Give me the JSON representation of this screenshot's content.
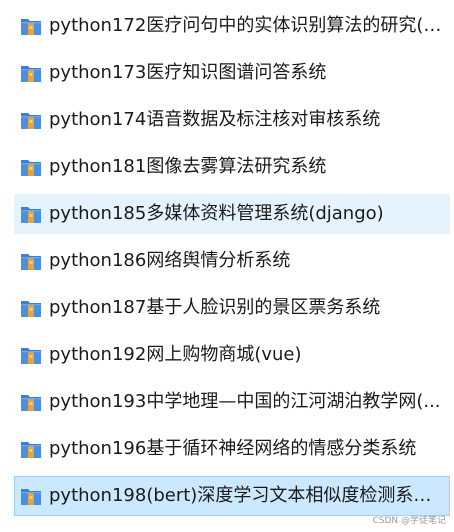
{
  "folders": [
    {
      "name": "python172医疗问句中的实体识别算法的研究(f...",
      "state": "normal"
    },
    {
      "name": "python173医疗知识图谱问答系统",
      "state": "normal"
    },
    {
      "name": "python174语音数据及标注核对审核系统",
      "state": "normal"
    },
    {
      "name": "python181图像去雾算法研究系统",
      "state": "normal"
    },
    {
      "name": "python185多媒体资料管理系统(django)",
      "state": "hover"
    },
    {
      "name": "python186网络舆情分析系统",
      "state": "normal"
    },
    {
      "name": "python187基于人脸识别的景区票务系统",
      "state": "normal"
    },
    {
      "name": "python192网上购物商城(vue)",
      "state": "normal"
    },
    {
      "name": "python193中学地理—中国的江河湖泊教学网(...",
      "state": "normal"
    },
    {
      "name": "python196基于循环神经网络的情感分类系统",
      "state": "normal"
    },
    {
      "name": "python198(bert)深度学习文本相似度检测系统...",
      "state": "selected"
    }
  ],
  "icon": "folder-icon",
  "watermark": "CSDN @学徒笔记",
  "colors": {
    "hover_bg": "#e5f3ff",
    "selected_bg": "#cce8ff",
    "selected_border": "#99d1ff",
    "text": "#1a1a1a"
  }
}
